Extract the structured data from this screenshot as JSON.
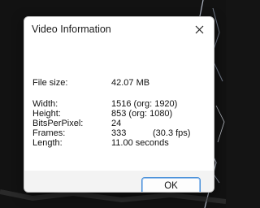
{
  "dialog": {
    "title": "Video Information",
    "close_icon": "close-icon",
    "ok_label": "OK"
  },
  "info": {
    "file_size": {
      "label": "File size:",
      "value": "42.07 MB"
    },
    "width": {
      "label": "Width:",
      "value": "1516 (org: 1920)"
    },
    "height": {
      "label": "Height:",
      "value": "853 (org: 1080)"
    },
    "bits": {
      "label": "BitsPerPixel:",
      "value": "24"
    },
    "frames": {
      "label": "Frames:",
      "value": "333",
      "fps": "(30.3 fps)"
    },
    "length": {
      "label": "Length:",
      "value": "11.00 seconds"
    }
  },
  "colors": {
    "ok_border": "#4a90d9",
    "dialog_bg": "#f3f3f3"
  }
}
